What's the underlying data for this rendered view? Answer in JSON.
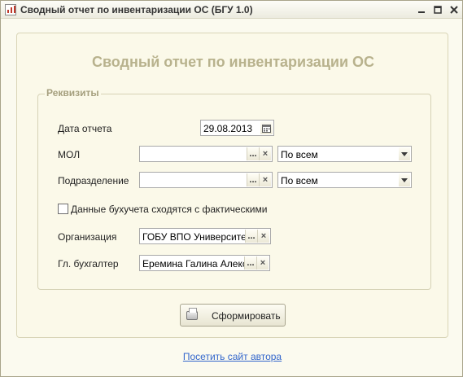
{
  "window": {
    "title": "Сводный отчет по инвентаризации ОС (БГУ 1.0)",
    "minimize_icon": "minimize-icon",
    "close_icon": "close-icon"
  },
  "report": {
    "title": "Сводный отчет по инвентаризации ОС"
  },
  "requisites": {
    "group_label": "Реквизиты",
    "report_date": {
      "label": "Дата отчета",
      "value": "29.08.2013"
    },
    "mol": {
      "label": "МОЛ",
      "value": "",
      "filter": "По всем"
    },
    "department": {
      "label": "Подразделение",
      "value": "",
      "filter": "По всем"
    },
    "match_checkbox": {
      "label": "Данные бухучета сходятся с фактическими",
      "checked": false
    },
    "organization": {
      "label": "Организация",
      "value": "ГОБУ ВПО Университет"
    },
    "chief_accountant": {
      "label": "Гл. бухгалтер",
      "value": "Еремина Галина Алексан"
    }
  },
  "buttons": {
    "select_glyph": "...",
    "clear_glyph": "×",
    "generate_label": "Сформировать"
  },
  "footer": {
    "author_link": "Посетить сайт автора"
  },
  "colors": {
    "window_bg": "#fbfaef",
    "title_accent": "#b8b28d",
    "link": "#3366cc"
  }
}
